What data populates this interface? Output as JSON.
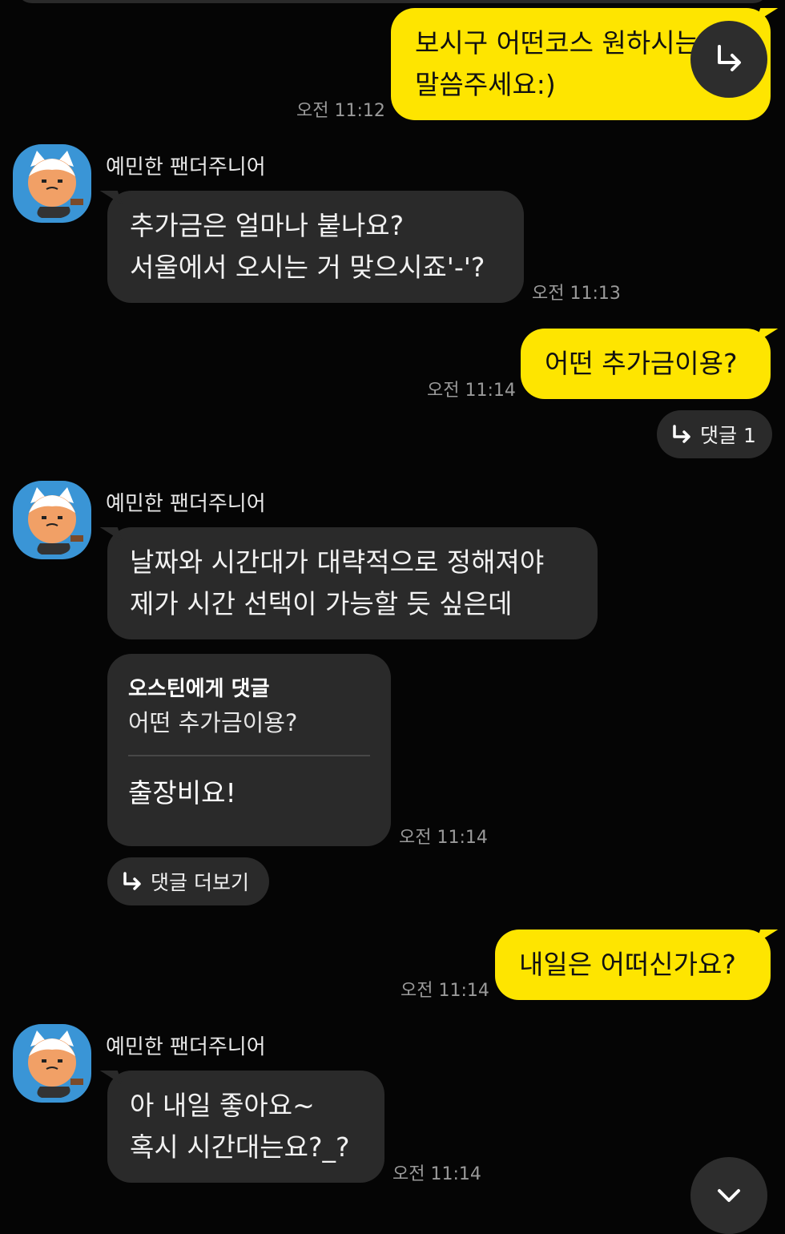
{
  "messages": {
    "m1": {
      "lines": [
        "보시구 어떤코스 원하시는지",
        "말씀주세요:)"
      ],
      "time": "오전 11:12"
    },
    "m2": {
      "sender": "예민한 팬더주니어",
      "lines": [
        "추가금은 얼마나 붙나요?",
        "서울에서 오시는 거 맞으시죠'-'?"
      ],
      "time": "오전 11:13"
    },
    "m3": {
      "lines": [
        "어떤 추가금이용?"
      ],
      "time": "오전 11:14",
      "reply_label": "댓글 1"
    },
    "m4": {
      "sender": "예민한 팬더주니어",
      "lines": [
        "날짜와 시간대가 대략적으로 정해져야",
        "제가 시간 선택이 가능할 듯 싶은데"
      ]
    },
    "m5": {
      "reply_title": "오스틴에게 댓글",
      "reply_quote": "어떤 추가금이용?",
      "body": "출장비요!",
      "time": "오전 11:14",
      "more_label": "댓글 더보기"
    },
    "m6": {
      "lines": [
        "내일은 어떠신가요?"
      ],
      "time": "오전 11:14"
    },
    "m7": {
      "sender": "예민한 팬더주니어",
      "lines": [
        "아 내일 좋아요~",
        "혹시 시간대는요?_?"
      ],
      "time": "오전 11:14"
    }
  },
  "colors": {
    "my_bubble": "#fee500",
    "other_bubble": "#2a2a2a",
    "background": "#050505",
    "avatar_bg": "#3a95d6"
  },
  "icons": {
    "reply": "reply-arrow-icon",
    "share": "share-arrow-icon",
    "scroll": "chevron-down-icon",
    "avatar": "red-panda-avatar-icon"
  }
}
